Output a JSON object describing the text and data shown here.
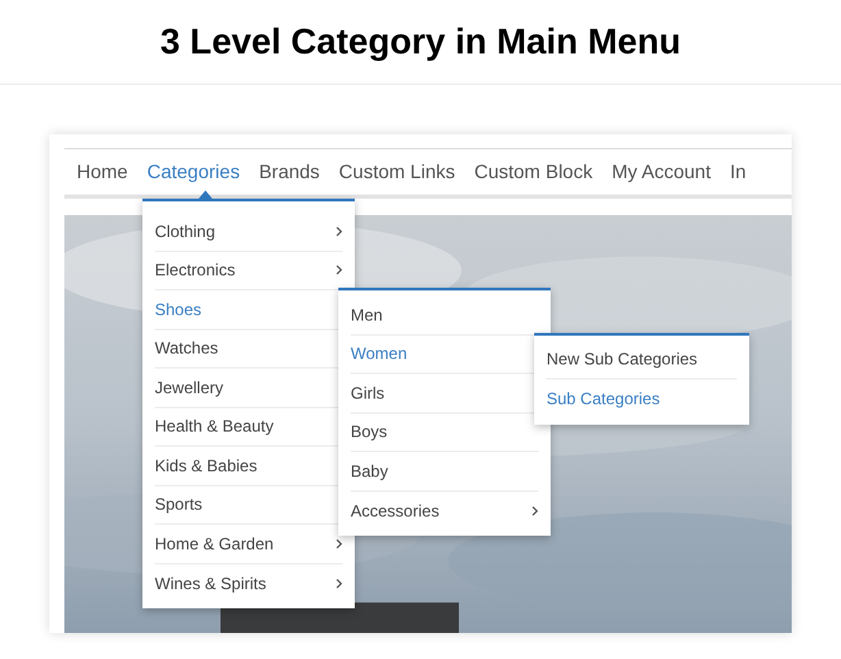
{
  "heading": "3 Level Category in Main Menu",
  "nav": [
    {
      "label": "Home",
      "selected": false
    },
    {
      "label": "Categories",
      "selected": true,
      "children": [
        {
          "label": "Clothing",
          "selected": false,
          "arrow": true
        },
        {
          "label": "Electronics",
          "selected": false,
          "arrow": true
        },
        {
          "label": "Shoes",
          "selected": true,
          "arrow": false,
          "children": [
            {
              "label": "Men",
              "selected": false,
              "arrow": false
            },
            {
              "label": "Women",
              "selected": true,
              "arrow": false,
              "children": [
                {
                  "label": "New Sub Categories",
                  "selected": false,
                  "arrow": false
                },
                {
                  "label": "Sub Categories",
                  "selected": true,
                  "arrow": false
                }
              ]
            },
            {
              "label": "Girls",
              "selected": false,
              "arrow": false
            },
            {
              "label": "Boys",
              "selected": false,
              "arrow": false
            },
            {
              "label": "Baby",
              "selected": false,
              "arrow": false
            },
            {
              "label": "Accessories",
              "selected": false,
              "arrow": true
            }
          ]
        },
        {
          "label": "Watches",
          "selected": false,
          "arrow": false
        },
        {
          "label": "Jewellery",
          "selected": false,
          "arrow": false
        },
        {
          "label": "Health & Beauty",
          "selected": false,
          "arrow": false
        },
        {
          "label": "Kids & Babies",
          "selected": false,
          "arrow": false
        },
        {
          "label": "Sports",
          "selected": false,
          "arrow": false
        },
        {
          "label": "Home & Garden",
          "selected": false,
          "arrow": true
        },
        {
          "label": "Wines & Spirits",
          "selected": false,
          "arrow": true
        }
      ]
    },
    {
      "label": "Brands",
      "selected": false
    },
    {
      "label": "Custom Links",
      "selected": false
    },
    {
      "label": "Custom Block",
      "selected": false
    },
    {
      "label": "My Account",
      "selected": false
    },
    {
      "label": "In",
      "selected": false
    }
  ]
}
